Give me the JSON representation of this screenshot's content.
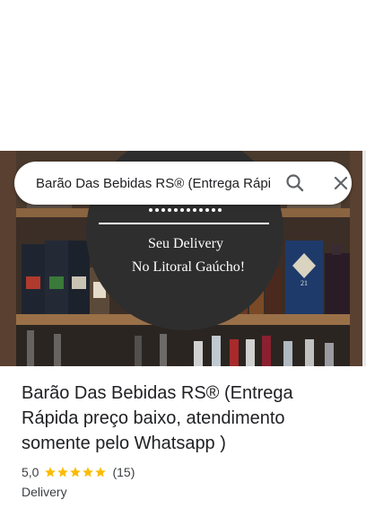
{
  "search": {
    "value": "Barão Das Bebidas RS® (Entrega Rápida preço baixo, atendimento somente pelo Whatsapp )"
  },
  "hero": {
    "sign_line1": "Seu Delivery",
    "sign_line2": "No Litoral Gaúcho!",
    "bottle_label": "21"
  },
  "place": {
    "title": "Barão Das Bebidas RS® (Entrega Rápida preço baixo, atendimento somente pelo Whatsapp )",
    "rating": "5,0",
    "stars": 5,
    "reviews": "(15)",
    "category": "Delivery"
  },
  "colors": {
    "star": "#fbbc04",
    "text_primary": "#202124",
    "text_secondary": "#3c4043"
  },
  "icons": {
    "search": "search-icon",
    "close": "close-icon",
    "star": "star-icon"
  }
}
